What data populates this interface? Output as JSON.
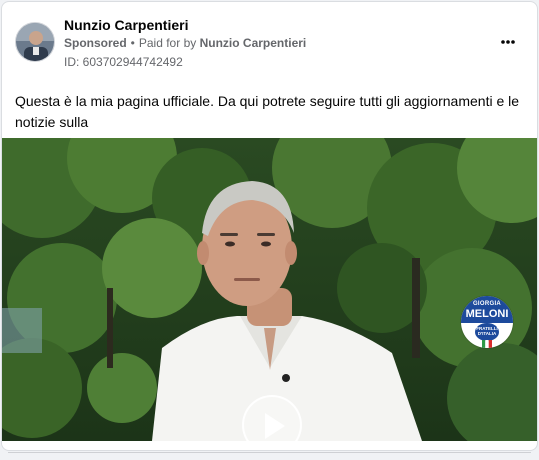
{
  "post": {
    "author_name": "Nunzio Carpentieri",
    "sponsored_label": "Sponsored",
    "separator": "•",
    "paid_for_prefix": "Paid for by",
    "paid_for_name": "Nunzio Carpentieri",
    "ad_id": "ID: 603702944742492",
    "text": "Questa è la mia pagina ufficiale. Da qui potrete seguire tutti gli aggiornamenti e le notizie sulla",
    "more_icon": "three-dots-icon"
  },
  "video": {
    "play_icon": "play-icon",
    "logo": {
      "line1": "GIORGIA",
      "line2": "MELONI",
      "badge_line1": "FRATELLI",
      "badge_line2": "D'ITALIA"
    }
  },
  "colors": {
    "card_background": "#ffffff",
    "page_background": "#f0f2f5",
    "text_primary": "#050505",
    "text_secondary": "#65676b",
    "logo_blue": "#1d4a9c"
  }
}
